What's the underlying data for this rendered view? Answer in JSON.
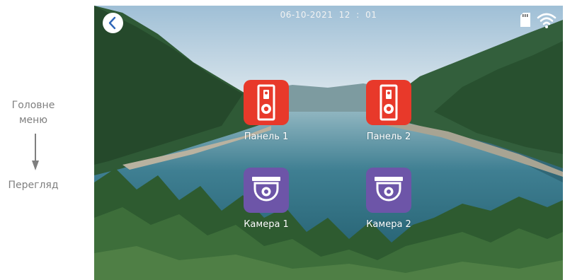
{
  "caption": {
    "top": "Головне\nменю",
    "bottom": "Перегляд",
    "text_color": "#7f7f7f"
  },
  "status_bar": {
    "date": "06-10-2021",
    "time": "12 : 01"
  },
  "tiles": [
    {
      "label": "Панель 1",
      "icon": "doorbell-panel-icon",
      "color": "#e8392a"
    },
    {
      "label": "Панель 2",
      "icon": "doorbell-panel-icon",
      "color": "#e8392a"
    },
    {
      "label": "Камера 1",
      "icon": "dome-camera-icon",
      "color": "#6d55a8"
    },
    {
      "label": "Камера 2",
      "icon": "dome-camera-icon",
      "color": "#6d55a8"
    }
  ],
  "icons": {
    "back": "back-arrow-icon",
    "storage": "sd-card-icon",
    "network": "wifi-icon"
  }
}
